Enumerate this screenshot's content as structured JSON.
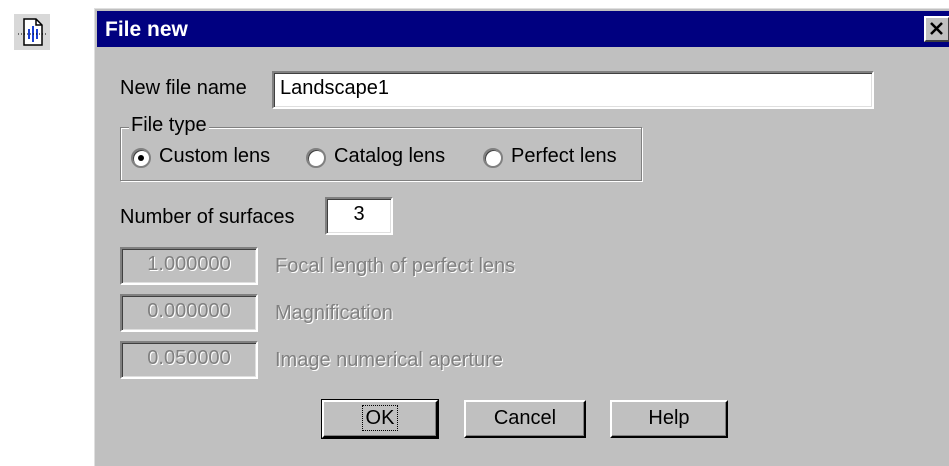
{
  "dialog": {
    "title": "File new",
    "close_label": "×"
  },
  "form": {
    "file_name_label": "New file name",
    "file_name_value": "Landscape1",
    "file_type_label": "File type",
    "file_type_options": [
      {
        "label": "Custom lens",
        "selected": true
      },
      {
        "label": "Catalog lens",
        "selected": false
      },
      {
        "label": "Perfect lens",
        "selected": false
      }
    ],
    "surfaces_label": "Number of surfaces",
    "surfaces_value": "3",
    "focal_value": "1.000000",
    "focal_label": "Focal length of perfect lens",
    "magnification_value": "0.000000",
    "magnification_label": "Magnification",
    "aperture_value": "0.050000",
    "aperture_label": "Image numerical aperture"
  },
  "buttons": {
    "ok": "OK",
    "cancel": "Cancel",
    "help": "Help"
  },
  "colors": {
    "titlebar": "#000080",
    "face": "#c0c0c0",
    "disabled_text": "#808080"
  }
}
